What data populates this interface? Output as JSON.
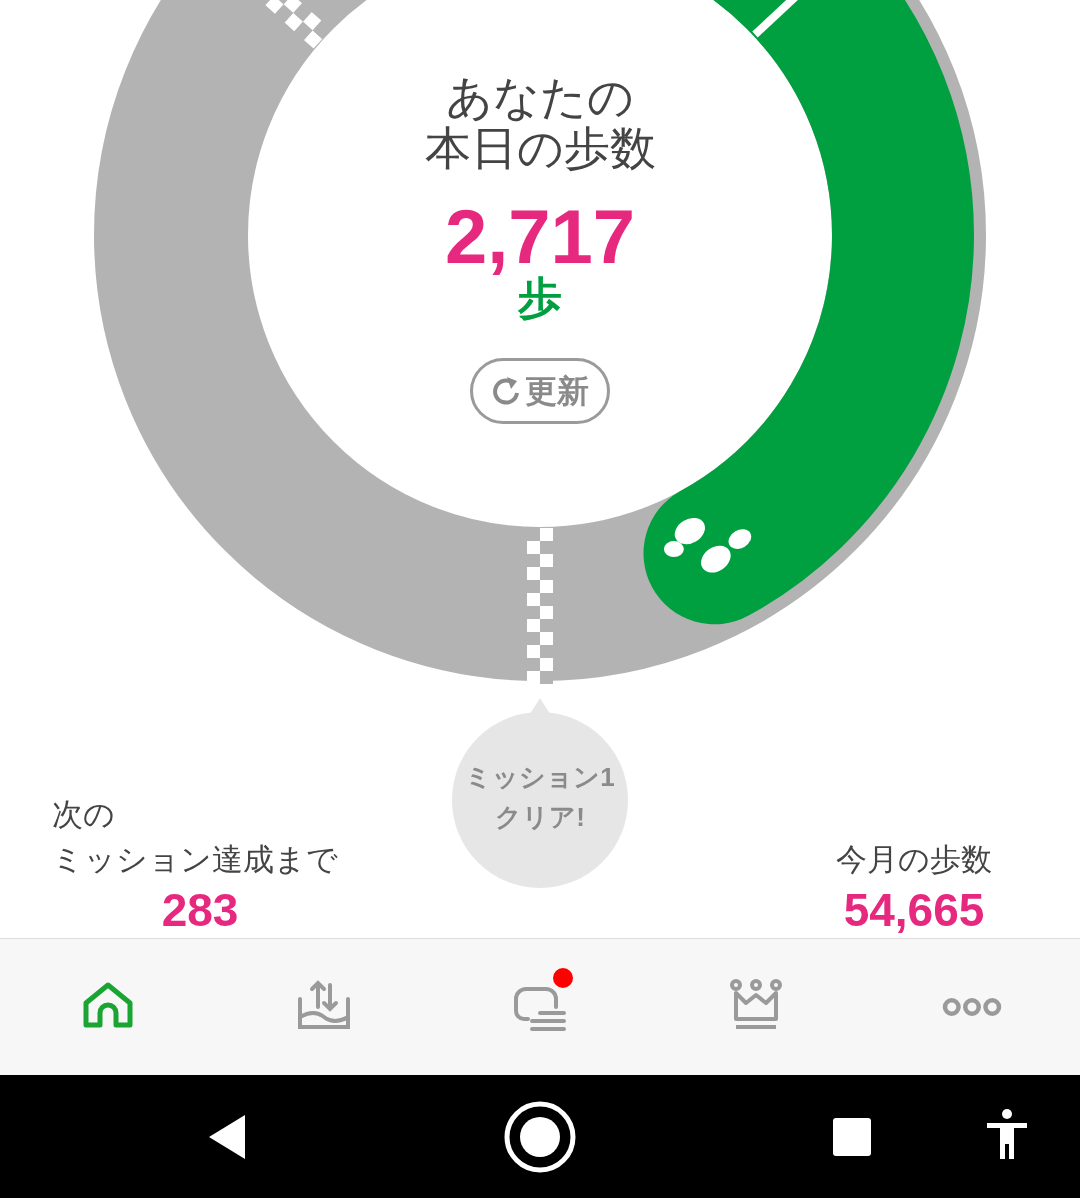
{
  "steps_ring": {
    "title_lines": [
      "あなたの",
      "本日の歩数"
    ],
    "steps": "2,717",
    "unit": "歩",
    "refresh_button": "更新"
  },
  "mission_bubble": {
    "lines": [
      "ミッション1",
      "クリア!"
    ]
  },
  "next_mission": {
    "label_lines": [
      "次の",
      "ミッション達成まで"
    ],
    "value": "283"
  },
  "monthly_steps": {
    "label": "今月の歩数",
    "value": "54,665"
  },
  "tabs": [
    {
      "kind": "home",
      "selected": true,
      "badge": false
    },
    {
      "kind": "transfer",
      "selected": false,
      "badge": false
    },
    {
      "kind": "chat",
      "selected": false,
      "badge": true
    },
    {
      "kind": "ranking",
      "selected": false,
      "badge": false
    },
    {
      "kind": "more",
      "selected": false,
      "badge": false
    }
  ],
  "system_nav": [
    {
      "kind": "back"
    },
    {
      "kind": "home"
    },
    {
      "kind": "recents"
    },
    {
      "kind": "accessibility"
    }
  ]
}
